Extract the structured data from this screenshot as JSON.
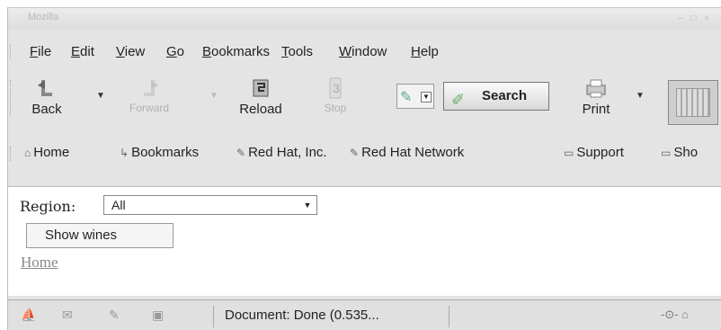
{
  "window": {
    "title": "Mozilla"
  },
  "menubar": {
    "items": [
      "File",
      "Edit",
      "View",
      "Go",
      "Bookmarks",
      "Tools",
      "Window",
      "Help"
    ]
  },
  "navbar": {
    "back_label": "Back",
    "forward_label": "Forward",
    "reload_label": "Reload",
    "stop_label": "Stop",
    "search_label": "Search",
    "print_label": "Print"
  },
  "personalbar": {
    "items": [
      "Home",
      "Bookmarks",
      "Red Hat, Inc.",
      "Red Hat Network",
      "Support",
      "Sho"
    ]
  },
  "content": {
    "region_label": "Region:",
    "region_value": "All",
    "show_button": "Show wines",
    "home_link": "Home"
  },
  "statusbar": {
    "status_text": "Document: Done (0.535..."
  }
}
